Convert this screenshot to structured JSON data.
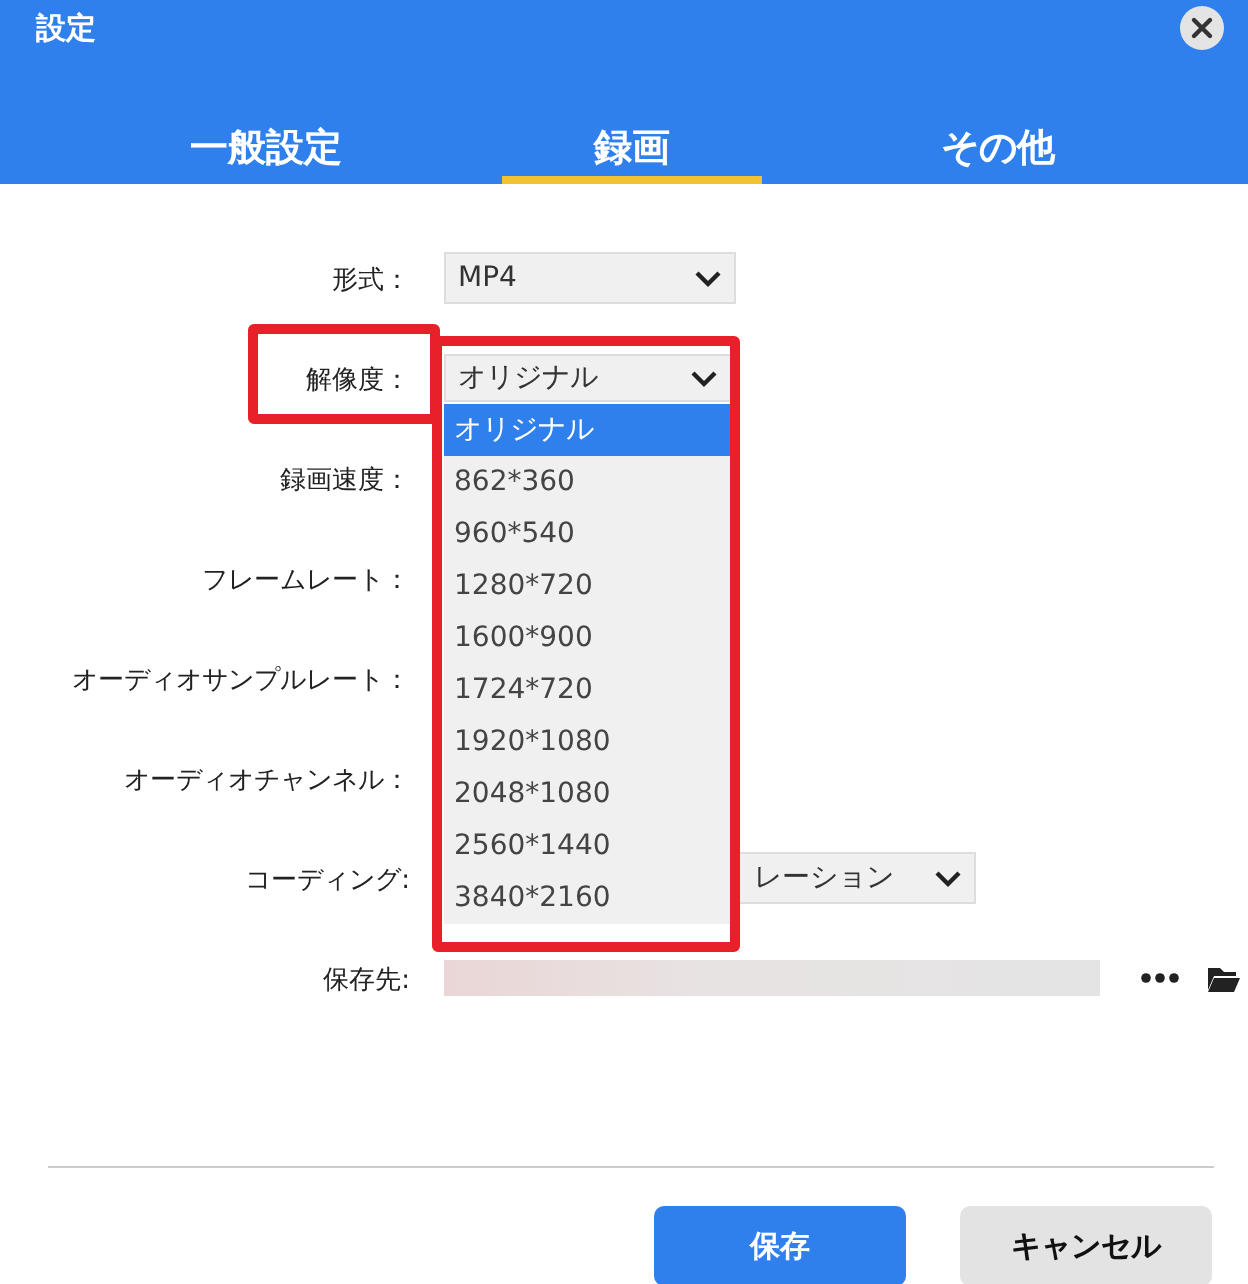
{
  "window": {
    "title": "設定"
  },
  "tabs": [
    {
      "label": "一般設定",
      "selected": false
    },
    {
      "label": "録画",
      "selected": true
    },
    {
      "label": "その他",
      "selected": false
    }
  ],
  "rows": [
    {
      "label": "形式：",
      "control": {
        "kind": "select",
        "value": "MP4"
      }
    },
    {
      "label": "解像度：",
      "highlighted": true,
      "control": {
        "kind": "select",
        "value": "オリジナル",
        "expanded": true,
        "options": [
          {
            "label": "オリジナル",
            "selected": true
          },
          {
            "label": "862*360",
            "selected": false
          },
          {
            "label": "960*540",
            "selected": false
          },
          {
            "label": "1280*720",
            "selected": false
          },
          {
            "label": "1600*900",
            "selected": false
          },
          {
            "label": "1724*720",
            "selected": false
          },
          {
            "label": "1920*1080",
            "selected": false
          },
          {
            "label": "2048*1080",
            "selected": false
          },
          {
            "label": "2560*1440",
            "selected": false
          },
          {
            "label": "3840*2160",
            "selected": false
          }
        ]
      }
    },
    {
      "label": "録画速度："
    },
    {
      "label": "フレームレート："
    },
    {
      "label": "オーディオサンプルレート："
    },
    {
      "label": "オーディオチャンネル："
    },
    {
      "label": "コーディング:",
      "control": {
        "kind": "select",
        "value": "レーション",
        "partly_hidden": true
      }
    },
    {
      "label": "保存先:",
      "control": {
        "kind": "path"
      }
    }
  ],
  "buttons": [
    {
      "label": "保存",
      "kind": "primary"
    },
    {
      "label": "キャンセル",
      "kind": "secondary"
    }
  ]
}
